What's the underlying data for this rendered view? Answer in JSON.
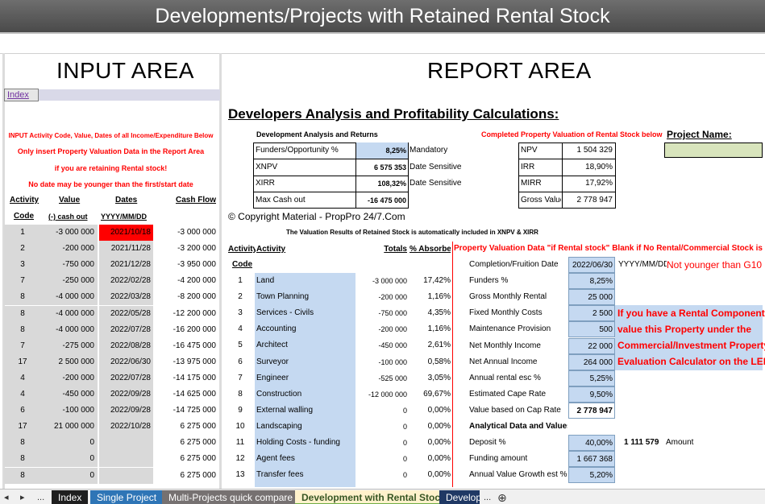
{
  "window": {
    "title": "Developments/Projects with Retained Rental Stock"
  },
  "areas": {
    "input_title": "INPUT AREA",
    "report_title": "REPORT AREA",
    "index_link": "Index"
  },
  "input_notes": [
    "INPUT Activity Code, Value, Dates of all Income/Expenditure Below",
    "Only insert Property Valuation Data in the Report Area",
    "if you are retaining Rental stock!",
    "No date may be younger than the first/start date"
  ],
  "input_table": {
    "headers1": [
      "Activity",
      "Value",
      "Dates",
      "Cash Flow"
    ],
    "headers2": [
      "Code",
      "(-) cash out",
      "YYYY/MM/DD",
      ""
    ],
    "rows": [
      [
        "1",
        "-3 000 000",
        "2021/10/18",
        "-3 000 000"
      ],
      [
        "2",
        "-200 000",
        "2021/11/28",
        "-3 200 000"
      ],
      [
        "3",
        "-750 000",
        "2021/12/28",
        "-3 950 000"
      ],
      [
        "7",
        "-250 000",
        "2022/02/28",
        "-4 200 000"
      ],
      [
        "8",
        "-4 000 000",
        "2022/03/28",
        "-8 200 000"
      ],
      [
        "8",
        "-4 000 000",
        "2022/05/28",
        "-12 200 000"
      ],
      [
        "8",
        "-4 000 000",
        "2022/07/28",
        "-16 200 000"
      ],
      [
        "7",
        "-275 000",
        "2022/08/28",
        "-16 475 000"
      ],
      [
        "17",
        "2 500 000",
        "2022/06/30",
        "-13 975 000"
      ],
      [
        "4",
        "-200 000",
        "2022/07/28",
        "-14 175 000"
      ],
      [
        "4",
        "-450 000",
        "2022/09/28",
        "-14 625 000"
      ],
      [
        "6",
        "-100 000",
        "2022/09/28",
        "-14 725 000"
      ],
      [
        "17",
        "21 000 000",
        "2022/10/28",
        "6 275 000"
      ],
      [
        "8",
        "0",
        "",
        "6 275 000"
      ],
      [
        "8",
        "0",
        "",
        "6 275 000"
      ],
      [
        "8",
        "0",
        "",
        "6 275 000"
      ]
    ]
  },
  "report": {
    "heading": "Developers Analysis and Profitability Calculations:",
    "dev_analysis_title": "Development Analysis and Returns",
    "dev_analysis": [
      [
        "Funders/Opportunity %",
        "8,25%",
        "Mandatory"
      ],
      [
        "XNPV",
        "6 575 353",
        "Date Sensitive"
      ],
      [
        "XIRR",
        "108,32%",
        "Date Sensitive"
      ],
      [
        "Max Cash out",
        "-16 475 000",
        ""
      ]
    ],
    "completed_title": "Completed Property Valuation of Rental Stock below",
    "completed": [
      [
        "NPV",
        "1 504 329"
      ],
      [
        "IRR",
        "18,90%"
      ],
      [
        "MIRR",
        "17,92%"
      ],
      [
        "Gross Value",
        "2 778 947"
      ]
    ],
    "project_name_label": "Project Name:",
    "project_name_value": "",
    "copyright": "© Copyright Material - PropPro 24/7.Com",
    "valuation_note": "The Valuation Results of Retained Stock is automatically included in XNPV & XIRR",
    "activity_headers": [
      "Activity",
      "Activity",
      "Totals",
      "% Absorbed"
    ],
    "activity_code_header": "Code",
    "activities": [
      [
        "1",
        "Land",
        "-3 000 000",
        "17,42%"
      ],
      [
        "2",
        "Town Planning",
        "-200 000",
        "1,16%"
      ],
      [
        "3",
        "Services - Civils",
        "-750 000",
        "4,35%"
      ],
      [
        "4",
        "Accounting",
        "-200 000",
        "1,16%"
      ],
      [
        "5",
        "Architect",
        "-450 000",
        "2,61%"
      ],
      [
        "6",
        "Surveyor",
        "-100 000",
        "0,58%"
      ],
      [
        "7",
        "Engineer",
        "-525 000",
        "3,05%"
      ],
      [
        "8",
        "Construction",
        "-12 000 000",
        "69,67%"
      ],
      [
        "9",
        "External walling",
        "0",
        "0,00%"
      ],
      [
        "10",
        "Landscaping",
        "0",
        "0,00%"
      ],
      [
        "11",
        "Holding Costs - funding",
        "0",
        "0,00%"
      ],
      [
        "12",
        "Agent fees",
        "0",
        "0,00%"
      ],
      [
        "13",
        "Transfer fees",
        "0",
        "0,00%"
      ]
    ],
    "prop_val_title": "Property Valuation Data \"if Rental stock\" Blank if No Rental/Commercial Stock is retained",
    "prop_val": [
      [
        "Completion/Fruition Date",
        "2022/06/30"
      ],
      [
        "Funders %",
        "8,25%"
      ],
      [
        "Gross Monthly Rental",
        "25 000"
      ],
      [
        "Fixed Monthly Costs",
        "2 500"
      ],
      [
        "Maintenance Provision",
        "500"
      ],
      [
        "Net Monthly Income",
        "22 000"
      ],
      [
        "Net Annual Income",
        "264 000"
      ],
      [
        "Annual rental esc %",
        "5,25%"
      ],
      [
        "Estimated Cape Rate",
        "9,50%"
      ],
      [
        "Value based on Cap Rate",
        "2 778 947"
      ],
      [
        "Analytical Data and Values",
        ""
      ],
      [
        "Deposit %",
        "40,00%"
      ],
      [
        "Funding amount",
        "1 667 368"
      ],
      [
        "Annual Value Growth est %",
        "5,20%"
      ]
    ],
    "date_format": "YYYY/MM/DD",
    "date_warning": "Not younger than G10",
    "deposit_amount": "1 111 579",
    "deposit_amount_label": "Amount",
    "rental_note": [
      "If you have a Rental Component",
      "value this Property under the",
      "Commercial/Investment Property",
      "Evaluation Calculator on the LEFT"
    ]
  },
  "sheet_tabs": {
    "nav": [
      "◂",
      "▸",
      "..."
    ],
    "tabs": [
      "Index",
      "Single Project",
      "Multi-Projects quick compare",
      "Development with Rental Stock",
      "Develop"
    ],
    "more": "...",
    "add": "⊕"
  },
  "colors": {
    "title_bg": "#595959",
    "input_grey": "#d9d9d9",
    "highlight_red": "#ff0000",
    "report_blue": "#c5d9f1"
  }
}
